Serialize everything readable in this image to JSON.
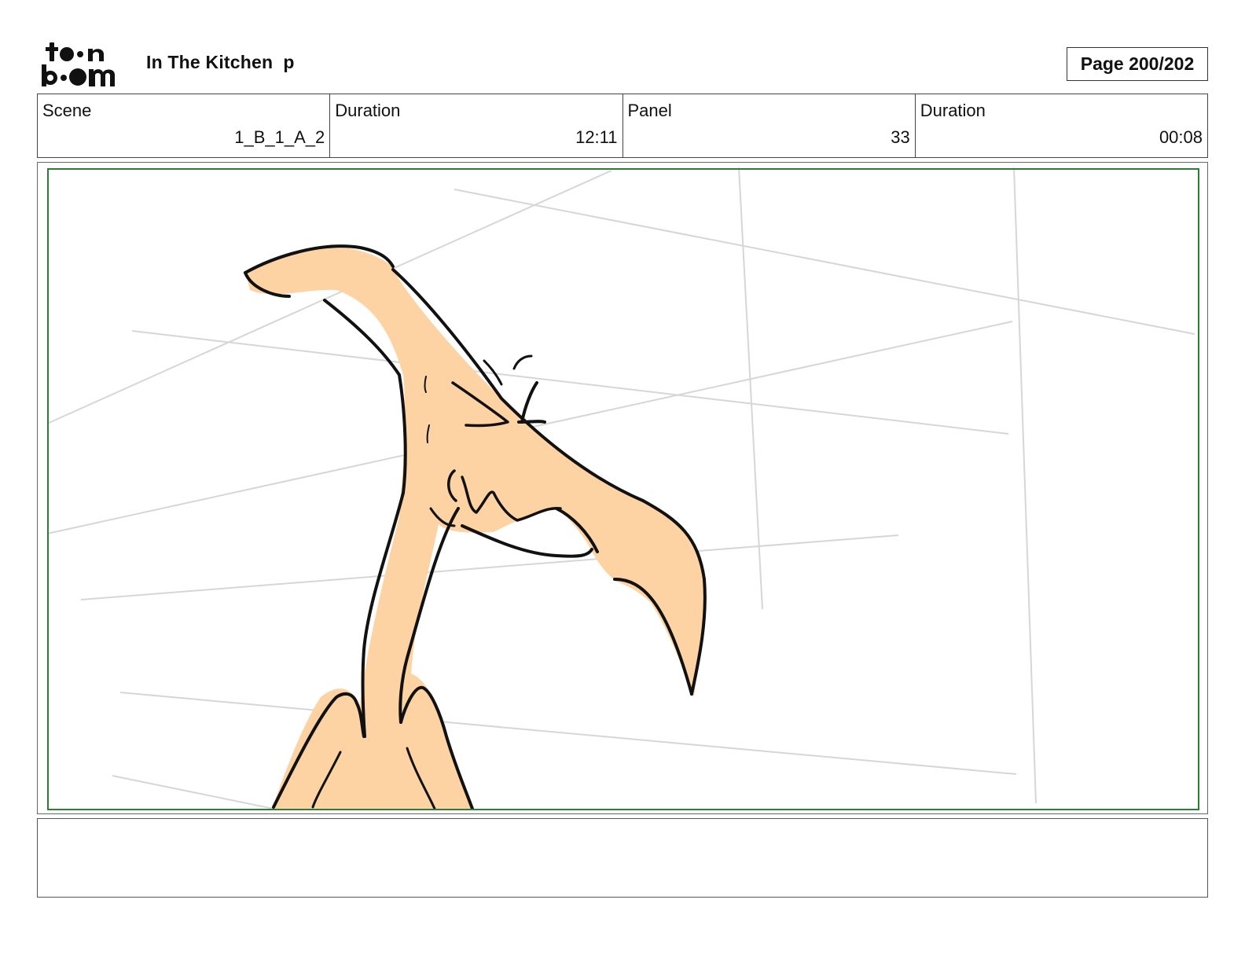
{
  "header": {
    "logo_text": "toonboom",
    "project_title": "In The Kitchen  p",
    "page_label": "Page 200/202"
  },
  "info": {
    "scene_label": "Scene",
    "scene_value": "1_B_1_A_2",
    "scene_duration_label": "Duration",
    "scene_duration_value": "12:11",
    "panel_label": "Panel",
    "panel_value": "33",
    "panel_duration_label": "Duration",
    "panel_duration_value": "00:08"
  },
  "notes": {
    "text": ""
  },
  "colors": {
    "safe_area_border": "#2e7d32",
    "skin_fill": "#fdd3a4",
    "ink": "#111111",
    "guide_lines": "#d4d4d4"
  }
}
